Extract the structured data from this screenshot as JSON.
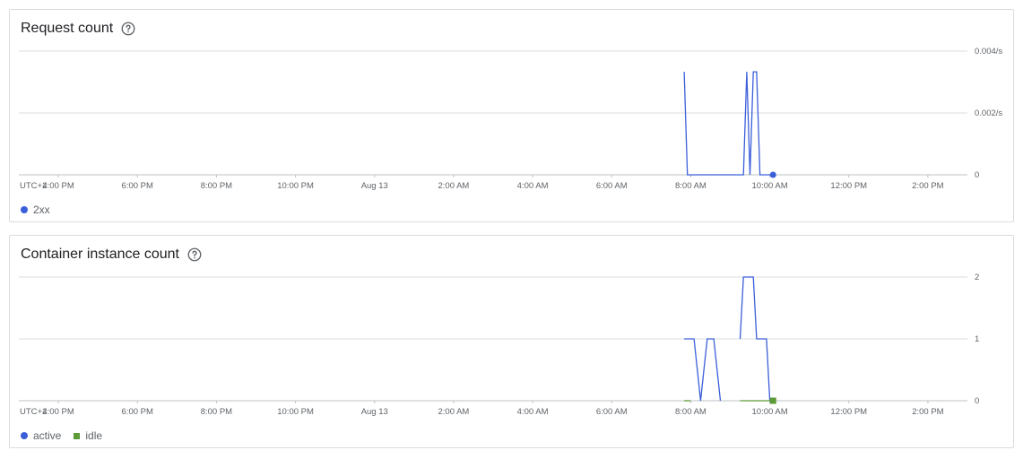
{
  "colors": {
    "active": "#3b5fd9",
    "idle": "#5c9b38",
    "grid": "#dadce0",
    "axis": "#5f6368"
  },
  "x_axis": {
    "timezone_label": "UTC+2",
    "start": "2023-08-12T15:00",
    "end": "2023-08-13T15:00",
    "ticks": [
      {
        "t": "2023-08-12T16:00",
        "label": "4:00 PM"
      },
      {
        "t": "2023-08-12T18:00",
        "label": "6:00 PM"
      },
      {
        "t": "2023-08-12T20:00",
        "label": "8:00 PM"
      },
      {
        "t": "2023-08-12T22:00",
        "label": "10:00 PM"
      },
      {
        "t": "2023-08-13T00:00",
        "label": "Aug 13"
      },
      {
        "t": "2023-08-13T02:00",
        "label": "2:00 AM"
      },
      {
        "t": "2023-08-13T04:00",
        "label": "4:00 AM"
      },
      {
        "t": "2023-08-13T06:00",
        "label": "6:00 AM"
      },
      {
        "t": "2023-08-13T08:00",
        "label": "8:00 AM"
      },
      {
        "t": "2023-08-13T10:00",
        "label": "10:00 AM"
      },
      {
        "t": "2023-08-13T12:00",
        "label": "12:00 PM"
      },
      {
        "t": "2023-08-13T14:00",
        "label": "2:00 PM"
      }
    ]
  },
  "chart_data": [
    {
      "type": "line",
      "title": "Request count",
      "y_ticks": [
        {
          "value": 0,
          "label": "0"
        },
        {
          "value": 0.002,
          "label": "0.002/s"
        },
        {
          "value": 0.004,
          "label": "0.004/s"
        }
      ],
      "ylim": [
        0,
        0.004
      ],
      "grid": true,
      "legend_position": "bottom-left",
      "series": [
        {
          "name": "2xx",
          "color_key": "active",
          "marker": "dot",
          "points": [
            {
              "x": "2023-08-13T07:50",
              "y": 0.00333
            },
            {
              "x": "2023-08-13T07:55",
              "y": 0
            },
            {
              "x": "2023-08-13T08:05",
              "y": 0
            },
            {
              "x": "2023-08-13T09:20",
              "y": 0
            },
            {
              "x": "2023-08-13T09:25",
              "y": 0.00333
            },
            {
              "x": "2023-08-13T09:30",
              "y": 0
            },
            {
              "x": "2023-08-13T09:35",
              "y": 0.00333
            },
            {
              "x": "2023-08-13T09:40",
              "y": 0.00333
            },
            {
              "x": "2023-08-13T09:45",
              "y": 0
            },
            {
              "x": "2023-08-13T10:05",
              "y": 0
            }
          ],
          "marker_at": {
            "x": "2023-08-13T10:05",
            "y": 0
          }
        }
      ]
    },
    {
      "type": "line",
      "title": "Container instance count",
      "y_ticks": [
        {
          "value": 0,
          "label": "0"
        },
        {
          "value": 1,
          "label": "1"
        },
        {
          "value": 2,
          "label": "2"
        }
      ],
      "ylim": [
        0,
        2
      ],
      "grid": true,
      "legend_position": "bottom-left",
      "series": [
        {
          "name": "active",
          "color_key": "active",
          "marker": "dot",
          "segments": [
            [
              {
                "x": "2023-08-13T07:50",
                "y": 1
              },
              {
                "x": "2023-08-13T08:05",
                "y": 1
              },
              {
                "x": "2023-08-13T08:15",
                "y": 0
              },
              {
                "x": "2023-08-13T08:25",
                "y": 1
              },
              {
                "x": "2023-08-13T08:35",
                "y": 1
              },
              {
                "x": "2023-08-13T08:45",
                "y": 0
              }
            ],
            [
              {
                "x": "2023-08-13T09:15",
                "y": 1
              },
              {
                "x": "2023-08-13T09:20",
                "y": 2
              },
              {
                "x": "2023-08-13T09:35",
                "y": 2
              },
              {
                "x": "2023-08-13T09:40",
                "y": 1
              },
              {
                "x": "2023-08-13T09:55",
                "y": 1
              },
              {
                "x": "2023-08-13T10:00",
                "y": 0
              }
            ]
          ]
        },
        {
          "name": "idle",
          "color_key": "idle",
          "marker": "square",
          "segments": [
            [
              {
                "x": "2023-08-13T07:50",
                "y": 0
              },
              {
                "x": "2023-08-13T08:00",
                "y": 0
              }
            ],
            [
              {
                "x": "2023-08-13T09:15",
                "y": 0
              },
              {
                "x": "2023-08-13T10:05",
                "y": 0
              }
            ]
          ],
          "marker_at": {
            "x": "2023-08-13T10:05",
            "y": 0
          }
        }
      ]
    }
  ]
}
